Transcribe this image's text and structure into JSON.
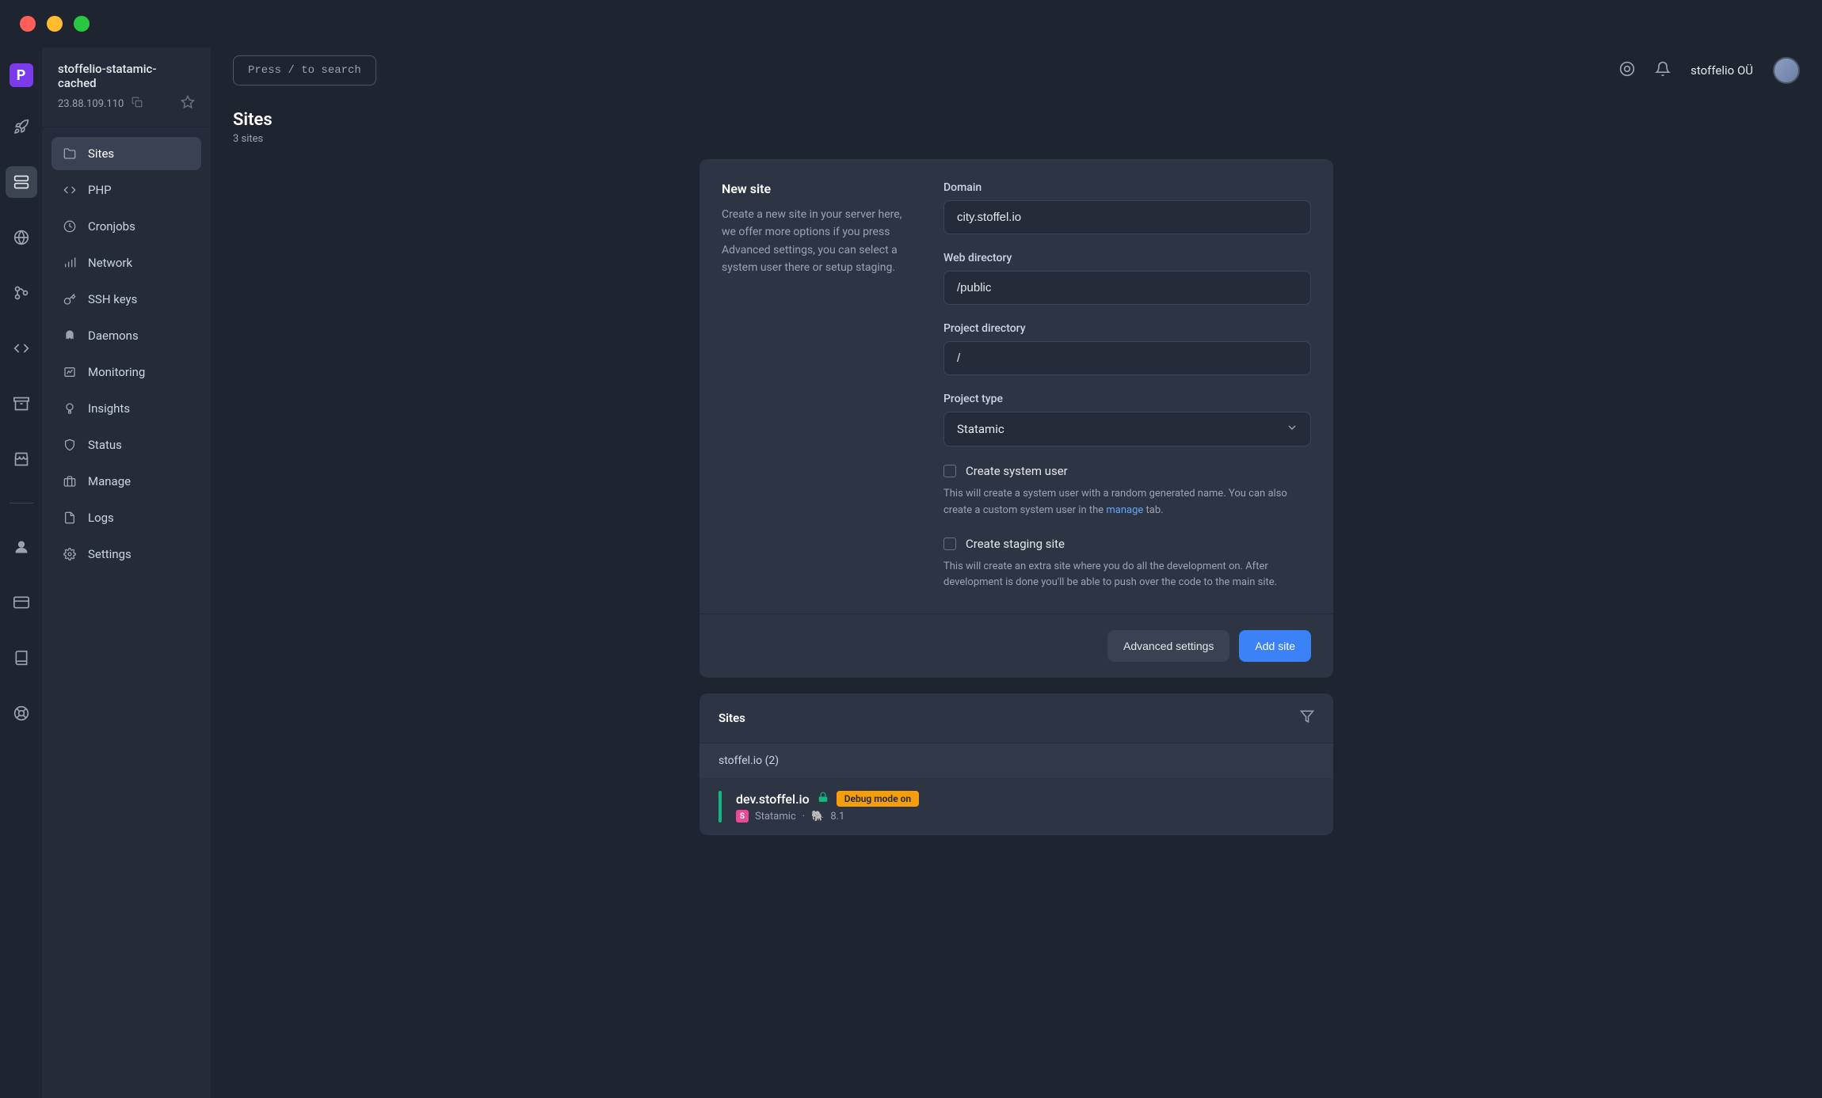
{
  "rail_logo": "P",
  "server": {
    "name": "stoffelio-statamic-cached",
    "ip": "23.88.109.110"
  },
  "sidebar_items": [
    {
      "label": "Sites",
      "active": true
    },
    {
      "label": "PHP"
    },
    {
      "label": "Cronjobs"
    },
    {
      "label": "Network"
    },
    {
      "label": "SSH keys"
    },
    {
      "label": "Daemons"
    },
    {
      "label": "Monitoring"
    },
    {
      "label": "Insights"
    },
    {
      "label": "Status"
    },
    {
      "label": "Manage"
    },
    {
      "label": "Logs"
    },
    {
      "label": "Settings"
    }
  ],
  "search_hint": "Press / to search",
  "user": "stoffelio OÜ",
  "page": {
    "title": "Sites",
    "subtitle": "3 sites"
  },
  "new_site": {
    "title": "New site",
    "desc": "Create a new site in your server here, we offer more options if you press Advanced settings, you can select a system user there or setup staging.",
    "domain_label": "Domain",
    "domain_value": "city.stoffel.io",
    "webdir_label": "Web directory",
    "webdir_value": "/public",
    "projdir_label": "Project directory",
    "projdir_value": "/",
    "type_label": "Project type",
    "type_value": "Statamic",
    "create_user_label": "Create system user",
    "create_user_help_1": "This will create a system user with a random generated name. You can also create a custom system user in the ",
    "create_user_help_link": "manage",
    "create_user_help_2": " tab.",
    "staging_label": "Create staging site",
    "staging_help": "This will create an extra site where you do all the development on. After development is done you'll be able to push over the code to the main site.",
    "advanced_btn": "Advanced settings",
    "add_btn": "Add site"
  },
  "sites_list": {
    "title": "Sites",
    "group": "stoffel.io (2)",
    "items": [
      {
        "name": "dev.stoffel.io",
        "badge": "Debug mode on",
        "tech": "Statamic",
        "tech_short": "S",
        "version": "8.1"
      }
    ]
  }
}
